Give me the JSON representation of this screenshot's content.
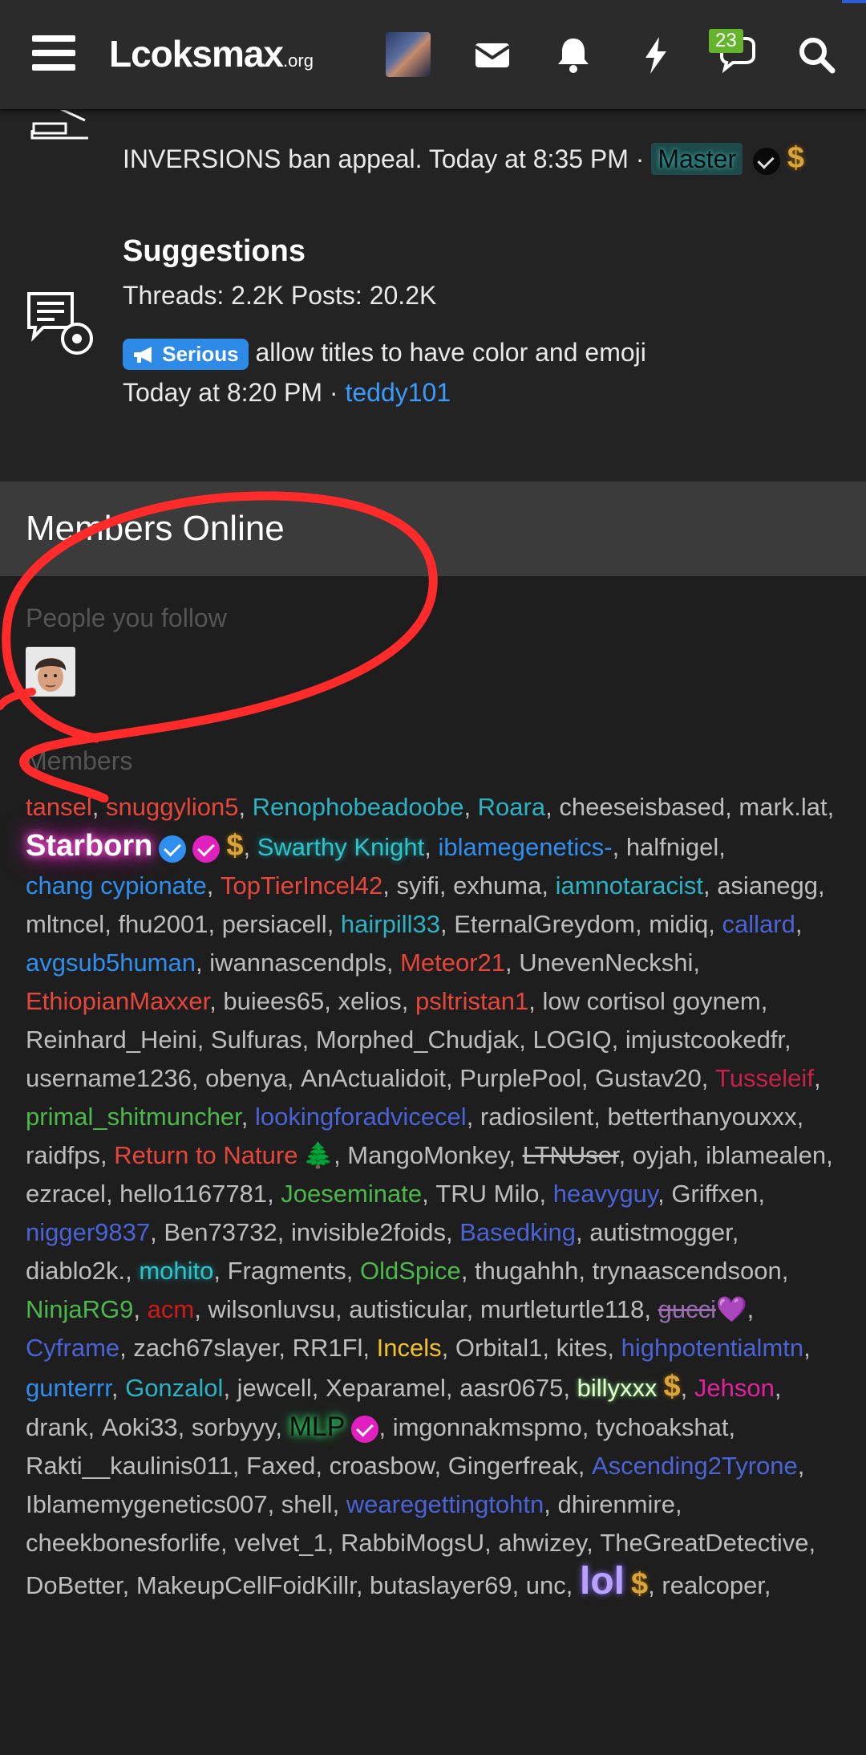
{
  "nav": {
    "logo": "Lcoksmax",
    "logo_suffix": ".org",
    "conversation_badge": "23",
    "icons": [
      "menu-icon",
      "envelope-icon",
      "bell-icon",
      "bolt-icon",
      "chat-icon",
      "search-icon"
    ]
  },
  "node_top": {
    "latest_text": "INVERSIONS ban appeal. Today at 8:35 PM · ",
    "user_title": "Master",
    "dollar": "$"
  },
  "suggestions": {
    "title": "Suggestions",
    "stats": "Threads: 2.2K Posts: 20.2K",
    "prefix": "Serious",
    "thread_title": "allow titles to have color and emoji",
    "when": "Today at 8:20 PM · ",
    "user": "teddy101"
  },
  "members_online": {
    "title": "Members Online",
    "follow_label": "People you follow",
    "members_label": "Members",
    "members": [
      {
        "name": "tansel",
        "style": "c-red"
      },
      {
        "name": "snuggylion5",
        "style": "c-red"
      },
      {
        "name": "Renophobeadoobe",
        "style": "c-cyan"
      },
      {
        "name": "Roara",
        "style": "c-cyan"
      },
      {
        "name": "cheeseisbased",
        "style": ""
      },
      {
        "name": "mark.lat",
        "style": ""
      },
      {
        "name": "Starborn",
        "style": "starborn",
        "badges": [
          "ver-blue",
          "ver-pink",
          "dollar"
        ]
      },
      {
        "name": "Swarthy Knight",
        "style": "c-teal-glow"
      },
      {
        "name": "iblamegenetics-",
        "style": "c-blue"
      },
      {
        "name": "halfnigel",
        "style": ""
      },
      {
        "name": "chang cypionate",
        "style": "c-blue"
      },
      {
        "name": "TopTierIncel42",
        "style": "c-red"
      },
      {
        "name": "syifi",
        "style": ""
      },
      {
        "name": "exhuma",
        "style": ""
      },
      {
        "name": "iamnotaracist",
        "style": "c-cyan"
      },
      {
        "name": "asianegg",
        "style": ""
      },
      {
        "name": "mltncel",
        "style": ""
      },
      {
        "name": "fhu2001",
        "style": ""
      },
      {
        "name": "persiacell",
        "style": ""
      },
      {
        "name": "hairpill33",
        "style": "c-cyan"
      },
      {
        "name": "EternalGreydom",
        "style": ""
      },
      {
        "name": "midiq",
        "style": ""
      },
      {
        "name": "callard",
        "style": "c-indigo"
      },
      {
        "name": "avgsub5human",
        "style": "c-blue"
      },
      {
        "name": "iwannascendpls",
        "style": ""
      },
      {
        "name": "Meteor21",
        "style": "c-red"
      },
      {
        "name": "UnevenNeckshi",
        "style": ""
      },
      {
        "name": "EthiopianMaxxer",
        "style": "c-red"
      },
      {
        "name": "buiees65",
        "style": ""
      },
      {
        "name": "xelios",
        "style": ""
      },
      {
        "name": "psltristan1",
        "style": "c-red"
      },
      {
        "name": "low cortisol goynem",
        "style": ""
      },
      {
        "name": "Reinhard_Heini",
        "style": ""
      },
      {
        "name": "Sulfuras",
        "style": ""
      },
      {
        "name": "Morphed_Chudjak",
        "style": ""
      },
      {
        "name": "LOGIQ",
        "style": ""
      },
      {
        "name": "imjustcookedfr",
        "style": ""
      },
      {
        "name": "username1236",
        "style": ""
      },
      {
        "name": "obenya",
        "style": ""
      },
      {
        "name": "AnActualidoit",
        "style": ""
      },
      {
        "name": "PurplePool",
        "style": ""
      },
      {
        "name": "Gustav20",
        "style": ""
      },
      {
        "name": "Tusseleif",
        "style": "c-crimson"
      },
      {
        "name": "primal_shitmuncher",
        "style": "c-green"
      },
      {
        "name": "lookingforadvicecel",
        "style": "c-indigo"
      },
      {
        "name": "radiosilent",
        "style": ""
      },
      {
        "name": "betterthanyouxxx",
        "style": ""
      },
      {
        "name": "raidfps",
        "style": ""
      },
      {
        "name": "Return to Nature",
        "style": "c-red",
        "badges": [
          "tree"
        ]
      },
      {
        "name": "MangoMonkey",
        "style": ""
      },
      {
        "name": "LTNUser",
        "style": "strike"
      },
      {
        "name": "oyjah",
        "style": ""
      },
      {
        "name": "iblamealen",
        "style": ""
      },
      {
        "name": "ezracel",
        "style": ""
      },
      {
        "name": "hello1167781",
        "style": ""
      },
      {
        "name": "Joeseminate",
        "style": "c-green"
      },
      {
        "name": "TRU Milo",
        "style": ""
      },
      {
        "name": "heavyguy",
        "style": "c-indigo"
      },
      {
        "name": "Griffxen",
        "style": ""
      },
      {
        "name": "nigger9837",
        "style": "c-indigo"
      },
      {
        "name": "Ben73732",
        "style": ""
      },
      {
        "name": "invisible2foids",
        "style": ""
      },
      {
        "name": "Basedking",
        "style": "c-indigo"
      },
      {
        "name": "autistmogger",
        "style": ""
      },
      {
        "name": "diablo2k.",
        "style": ""
      },
      {
        "name": "mohito",
        "style": "c-teal-glow"
      },
      {
        "name": "Fragments",
        "style": ""
      },
      {
        "name": "OldSpice",
        "style": "c-green"
      },
      {
        "name": "thugahhh",
        "style": ""
      },
      {
        "name": "trynaascendsoon",
        "style": ""
      },
      {
        "name": "NinjaRG9",
        "style": "c-green"
      },
      {
        "name": "acm",
        "style": "c-darkred"
      },
      {
        "name": "wilsonluvsu",
        "style": ""
      },
      {
        "name": "autisticular",
        "style": ""
      },
      {
        "name": "murtleturtle118",
        "style": ""
      },
      {
        "name": "gucci",
        "style": "gucci",
        "badges": [
          "heart"
        ]
      },
      {
        "name": "Cyframe",
        "style": "c-indigo"
      },
      {
        "name": "zach67slayer",
        "style": ""
      },
      {
        "name": "RR1Fl",
        "style": ""
      },
      {
        "name": "Incels",
        "style": "c-yellow"
      },
      {
        "name": "Orbital1",
        "style": ""
      },
      {
        "name": "kites",
        "style": ""
      },
      {
        "name": "highpotentialmtn",
        "style": "c-indigo"
      },
      {
        "name": "gunterrr",
        "style": "c-blue"
      },
      {
        "name": "Gonzalol",
        "style": "c-cyan"
      },
      {
        "name": "jewcell",
        "style": ""
      },
      {
        "name": "Xeparamel",
        "style": ""
      },
      {
        "name": "aasr0675",
        "style": ""
      },
      {
        "name": "billyxxx",
        "style": "billy",
        "badges": [
          "dollar"
        ]
      },
      {
        "name": "Jehson",
        "style": "c-magenta"
      },
      {
        "name": "drank",
        "style": ""
      },
      {
        "name": "Aoki33",
        "style": ""
      },
      {
        "name": "sorbyyy",
        "style": ""
      },
      {
        "name": "MLP",
        "style": "mlp",
        "badges": [
          "ver-pink"
        ]
      },
      {
        "name": "imgonnakmspmo",
        "style": ""
      },
      {
        "name": "tychoakshat",
        "style": ""
      },
      {
        "name": "Rakti__kaulinis011",
        "style": ""
      },
      {
        "name": "Faxed",
        "style": ""
      },
      {
        "name": "croasbow",
        "style": ""
      },
      {
        "name": "Gingerfreak",
        "style": ""
      },
      {
        "name": "Ascending2Tyrone",
        "style": "c-indigo"
      },
      {
        "name": "Iblamemygenetics007",
        "style": ""
      },
      {
        "name": "shell",
        "style": ""
      },
      {
        "name": "wearegettingtohtn",
        "style": "c-indigo"
      },
      {
        "name": "dhirenmire",
        "style": ""
      },
      {
        "name": "cheekbonesforlife",
        "style": ""
      },
      {
        "name": "velvet_1",
        "style": ""
      },
      {
        "name": "RabbiMogsU",
        "style": ""
      },
      {
        "name": "ahwizey",
        "style": ""
      },
      {
        "name": "TheGreatDetective",
        "style": ""
      },
      {
        "name": "DoBetter",
        "style": ""
      },
      {
        "name": "MakeupCellFoidKillr",
        "style": ""
      },
      {
        "name": "butaslayer69",
        "style": ""
      },
      {
        "name": "unc",
        "style": ""
      },
      {
        "name": "lol",
        "style": "lol",
        "badges": [
          "dollar"
        ]
      },
      {
        "name": "realcoper",
        "style": ""
      }
    ]
  },
  "colors": {
    "nav_bg": "#2b2b2b",
    "page_bg": "#1b1b1b",
    "prefix_blue": "#2d8ae6",
    "link_blue": "#3a9bff",
    "annotation_red": "#ff2a2a"
  }
}
